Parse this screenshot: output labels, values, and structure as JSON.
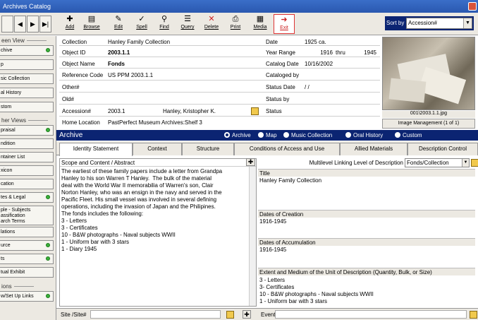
{
  "window": {
    "title": "Archives Catalog"
  },
  "toolbar": {
    "nav": [
      "◀",
      "◀",
      "▶",
      "▶|"
    ],
    "buttons": [
      {
        "label": "Add",
        "icon": "add-icon"
      },
      {
        "label": "Browse",
        "icon": "browse-icon"
      },
      {
        "label": "Edit",
        "icon": "edit-icon"
      },
      {
        "label": "Spell",
        "icon": "spell-icon"
      },
      {
        "label": "Find",
        "icon": "find-icon"
      },
      {
        "label": "Query",
        "icon": "query-icon"
      },
      {
        "label": "Delete",
        "icon": "delete-icon"
      },
      {
        "label": "Print",
        "icon": "print-icon"
      },
      {
        "label": "Media",
        "icon": "media-icon"
      },
      {
        "label": "Exit",
        "icon": "exit-icon"
      }
    ],
    "sort_label": "Sort by",
    "sort_value": "Accession#"
  },
  "left_panel": {
    "screen_view_header": "een View",
    "screen_view_items": [
      {
        "label": "chive",
        "dot": true
      },
      {
        "label": "p",
        "dot": false
      },
      {
        "label": "sic Collection",
        "dot": false
      },
      {
        "label": "al History",
        "dot": false
      },
      {
        "label": "stom",
        "dot": false
      }
    ],
    "other_views_header": "her Views",
    "other_views_items": [
      {
        "label": "praisal",
        "dot": true
      },
      {
        "label": "ndition",
        "dot": false
      },
      {
        "label": "ntainer List",
        "dot": false
      },
      {
        "label": "xicon",
        "dot": false
      },
      {
        "label": "cation",
        "dot": false
      },
      {
        "label": "tes & Legal",
        "dot": true
      },
      {
        "label": "ple - Subjects\nassification\narch Terms",
        "dot": false
      },
      {
        "label": "lations",
        "dot": false
      },
      {
        "label": "urce",
        "dot": true
      },
      {
        "label": "ts",
        "dot": true
      },
      {
        "label": "tual Exhibit",
        "dot": false
      }
    ],
    "options_header": "ions",
    "options_items": [
      {
        "label": "w/Set Up Links",
        "dot": true
      }
    ]
  },
  "form": {
    "collection": {
      "label": "Collection",
      "value": "Hanley Family Collection"
    },
    "object_id": {
      "label": "Object ID",
      "value": "2003.1.1"
    },
    "object_name": {
      "label": "Object Name",
      "value": "Fonds"
    },
    "reference_code": {
      "label": "Reference Code",
      "value": "US PPM 2003.1.1"
    },
    "other": {
      "label": "Other#",
      "value": ""
    },
    "old": {
      "label": "Old#",
      "value": ""
    },
    "accession": {
      "label": "Accession#",
      "value": "2003.1",
      "name": "Hanley, Kristopher K."
    },
    "home_location": {
      "label": "Home Location",
      "value": "PastPerfect Museum Archives:Shelf 3"
    },
    "date": {
      "label": "Date",
      "value": "1925 ca."
    },
    "year_range": {
      "label": "Year Range",
      "from": "1916",
      "thru": "thru",
      "to": "1945"
    },
    "catalog_date": {
      "label": "Catalog Date",
      "value": "10/16/2002"
    },
    "cataloged_by": {
      "label": "Cataloged by",
      "value": ""
    },
    "status_date": {
      "label": "Status Date",
      "value": "/ /"
    },
    "status_by": {
      "label": "Status by",
      "value": ""
    },
    "status": {
      "label": "Status",
      "value": ""
    }
  },
  "image": {
    "caption": "001\\2003.1.1.jpg",
    "management": "Image Management (1 of 1)"
  },
  "archive_bar": {
    "title": "Archive",
    "radios": [
      {
        "label": "Archive",
        "checked": true
      },
      {
        "label": "Map",
        "checked": false
      },
      {
        "label": "Music Collection",
        "checked": false
      },
      {
        "label": "Oral History",
        "checked": false
      },
      {
        "label": "Custom",
        "checked": false
      }
    ]
  },
  "tabs": [
    {
      "label": "Identity Statement",
      "active": true
    },
    {
      "label": "Context",
      "active": false
    },
    {
      "label": "Structure",
      "active": false
    },
    {
      "label": "Conditions of Access and Use",
      "active": false
    },
    {
      "label": "Allied Materials",
      "active": false
    },
    {
      "label": "Description Control",
      "active": false
    }
  ],
  "scope": {
    "header": "Scope and Content / Abstract",
    "text": "The earliest of these family papers include a letter from Grandpa\nHanley to his son Warren T Hanley.  The bulk of the material\ndeal with the World War II memorabilia of Warren's son, Clair\nNorton Hanley, who was an ensign in the navy and served in the\nPacific Fleet. His small vessel was involved in several defining\noperations, including the invasion of Japan and the Philipines.\nThe fonds includes the following:\n3 - Letters\n3 - Certificates\n10 - B&W photographs - Naval subjects WWII\n1 - Uniform bar with 3 stars\n1 - Diary 1945"
  },
  "right": {
    "multilevel_label": "Multilevel Linking Level of Description",
    "multilevel_value": "Fonds/Collection",
    "title_label": "Title",
    "title_value": "Hanley Family Collection",
    "dates_creation_label": "Dates of Creation",
    "dates_creation_value": "1916-1945",
    "dates_accum_label": "Dates of Accumulation",
    "dates_accum_value": "1916-1945",
    "extent_label": "Extent and Medium of the Unit of Description (Quantity, Bulk, or Size)",
    "extent_value": "3 - Letters\n3- Certificates\n10 - B&W photographs - Naval subjects WWII\n1 - Uniform bar with 3 stars"
  },
  "bottom": {
    "site_label": "Site /Site#",
    "event_label": "Event"
  }
}
